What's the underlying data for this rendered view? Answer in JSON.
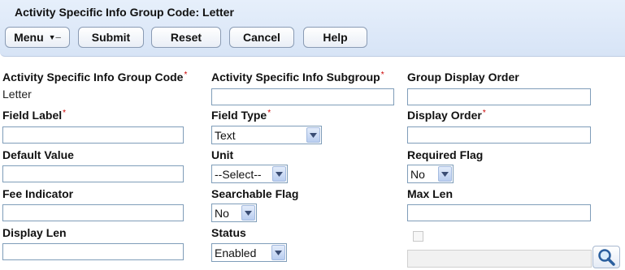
{
  "header": {
    "title": "Activity Specific Info Group Code: Letter",
    "buttons": {
      "menu": "Menu",
      "submit": "Submit",
      "reset": "Reset",
      "cancel": "Cancel",
      "help": "Help"
    }
  },
  "form": {
    "group_code": {
      "label": "Activity Specific Info Group Code",
      "required": "*",
      "value": "Letter"
    },
    "subgroup": {
      "label": "Activity Specific Info Subgroup",
      "required": "*",
      "value": ""
    },
    "group_display_order": {
      "label": "Group Display Order",
      "value": ""
    },
    "field_label": {
      "label": "Field Label",
      "required": "*",
      "value": ""
    },
    "field_type": {
      "label": "Field Type",
      "required": "*",
      "value": "Text"
    },
    "display_order": {
      "label": "Display Order",
      "required": "*",
      "value": ""
    },
    "default_value": {
      "label": "Default Value",
      "value": ""
    },
    "unit": {
      "label": "Unit",
      "value": "--Select--"
    },
    "required_flag": {
      "label": "Required Flag",
      "value": "No"
    },
    "fee_indicator": {
      "label": "Fee Indicator",
      "value": ""
    },
    "searchable_flag": {
      "label": "Searchable Flag",
      "value": "No"
    },
    "max_len": {
      "label": "Max Len",
      "value": ""
    },
    "display_len": {
      "label": "Display Len",
      "value": ""
    },
    "status": {
      "label": "Status",
      "value": "Enabled"
    }
  },
  "colors": {
    "header_bg": "#dbe6f6",
    "required_marker": "#cc0000",
    "input_border": "#7f9db9"
  },
  "icons": [
    "chevron-down-icon",
    "search-icon"
  ]
}
